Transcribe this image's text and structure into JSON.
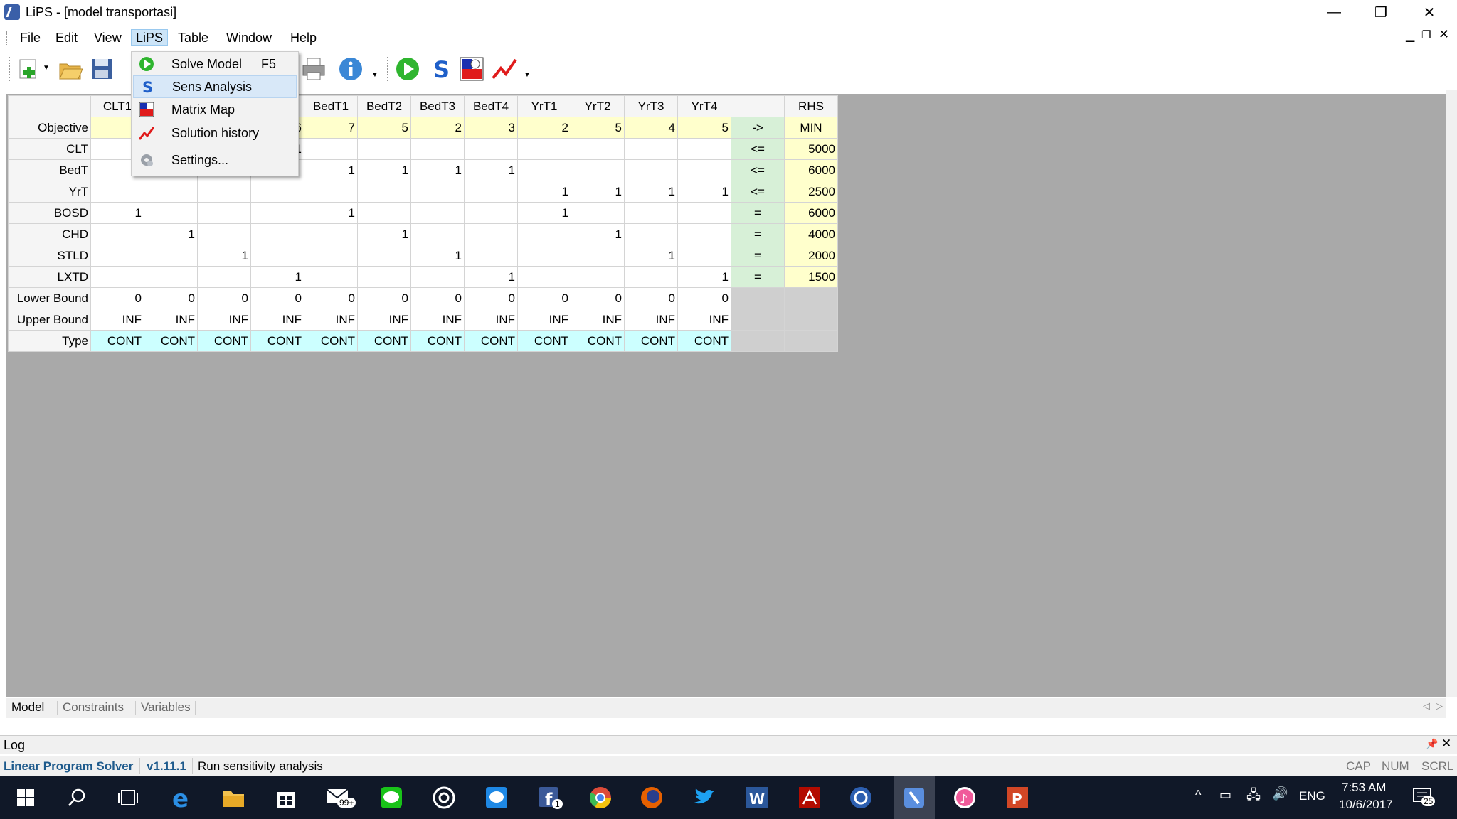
{
  "window": {
    "title": "LiPS - [model transportasi]",
    "controls": [
      "—",
      "❐",
      "✕"
    ]
  },
  "menu": {
    "items": [
      "File",
      "Edit",
      "View",
      "LiPS",
      "Table",
      "Window",
      "Help"
    ],
    "active": "LiPS"
  },
  "dropdown": {
    "items": [
      {
        "label": "Solve Model",
        "shortcut": "F5",
        "icon": "play-icon"
      },
      {
        "label": "Sens Analysis",
        "shortcut": "",
        "icon": "s-icon"
      },
      {
        "label": "Matrix Map",
        "shortcut": "",
        "icon": "matrix-icon"
      },
      {
        "label": "Solution history",
        "shortcut": "",
        "icon": "chart-icon"
      },
      {
        "label": "Settings...",
        "shortcut": "",
        "icon": "gear-icon"
      }
    ]
  },
  "grid": {
    "columns": [
      "CLT1",
      "",
      "",
      "",
      "BedT1",
      "BedT2",
      "BedT3",
      "BedT4",
      "YrT1",
      "YrT2",
      "YrT3",
      "YrT4",
      "",
      "RHS"
    ],
    "rows": [
      {
        "label": "Objective",
        "cells": [
          "",
          "",
          "",
          "6",
          "7",
          "5",
          "2",
          "3",
          "2",
          "5",
          "4",
          "5"
        ],
        "op": "->",
        "rhs": "MIN",
        "kind": "obj"
      },
      {
        "label": "CLT",
        "cells": [
          "",
          "",
          "",
          "1",
          "",
          "",
          "",
          "",
          "",
          "",
          "",
          ""
        ],
        "op": "<=",
        "rhs": "5000",
        "kind": "con"
      },
      {
        "label": "BedT",
        "cells": [
          "",
          "",
          "",
          "",
          "1",
          "1",
          "1",
          "1",
          "",
          "",
          "",
          ""
        ],
        "op": "<=",
        "rhs": "6000",
        "kind": "con"
      },
      {
        "label": "YrT",
        "cells": [
          "",
          "",
          "",
          "",
          "",
          "",
          "",
          "",
          "1",
          "1",
          "1",
          "1"
        ],
        "op": "<=",
        "rhs": "2500",
        "kind": "con"
      },
      {
        "label": "BOSD",
        "cells": [
          "1",
          "",
          "",
          "",
          "1",
          "",
          "",
          "",
          "1",
          "",
          "",
          ""
        ],
        "op": "=",
        "rhs": "6000",
        "kind": "con"
      },
      {
        "label": "CHD",
        "cells": [
          "",
          "1",
          "",
          "",
          "",
          "1",
          "",
          "",
          "",
          "1",
          "",
          ""
        ],
        "op": "=",
        "rhs": "4000",
        "kind": "con"
      },
      {
        "label": "STLD",
        "cells": [
          "",
          "",
          "1",
          "",
          "",
          "",
          "1",
          "",
          "",
          "",
          "1",
          ""
        ],
        "op": "=",
        "rhs": "2000",
        "kind": "con"
      },
      {
        "label": "LXTD",
        "cells": [
          "",
          "",
          "",
          "1",
          "",
          "",
          "",
          "1",
          "",
          "",
          "",
          "1"
        ],
        "op": "=",
        "rhs": "1500",
        "kind": "con"
      },
      {
        "label": "Lower Bound",
        "cells": [
          "0",
          "0",
          "0",
          "0",
          "0",
          "0",
          "0",
          "0",
          "0",
          "0",
          "0",
          "0"
        ],
        "op": "",
        "rhs": "",
        "kind": "bound"
      },
      {
        "label": "Upper Bound",
        "cells": [
          "INF",
          "INF",
          "INF",
          "INF",
          "INF",
          "INF",
          "INF",
          "INF",
          "INF",
          "INF",
          "INF",
          "INF"
        ],
        "op": "",
        "rhs": "",
        "kind": "bound"
      },
      {
        "label": "Type",
        "cells": [
          "CONT",
          "CONT",
          "CONT",
          "CONT",
          "CONT",
          "CONT",
          "CONT",
          "CONT",
          "CONT",
          "CONT",
          "CONT",
          "CONT"
        ],
        "op": "",
        "rhs": "",
        "kind": "type"
      }
    ]
  },
  "tabs": [
    "Model",
    "Constraints",
    "Variables"
  ],
  "log": {
    "title": "Log"
  },
  "status": {
    "app": "Linear Program Solver",
    "version": "v1.11.1",
    "message": "Run sensitivity analysis",
    "indicators": [
      "CAP",
      "NUM",
      "SCRL"
    ]
  },
  "taskbar": {
    "language": "ENG",
    "time": "7:53 AM",
    "date": "10/6/2017",
    "notifications": "25",
    "mail_badge": "99+",
    "fb_badge": "1"
  },
  "colors": {
    "objective": "#ffffcc",
    "operator": "#d7f0d7",
    "type": "#ccffff",
    "taskbar": "#101828",
    "status_app": "#1e5a8c"
  }
}
